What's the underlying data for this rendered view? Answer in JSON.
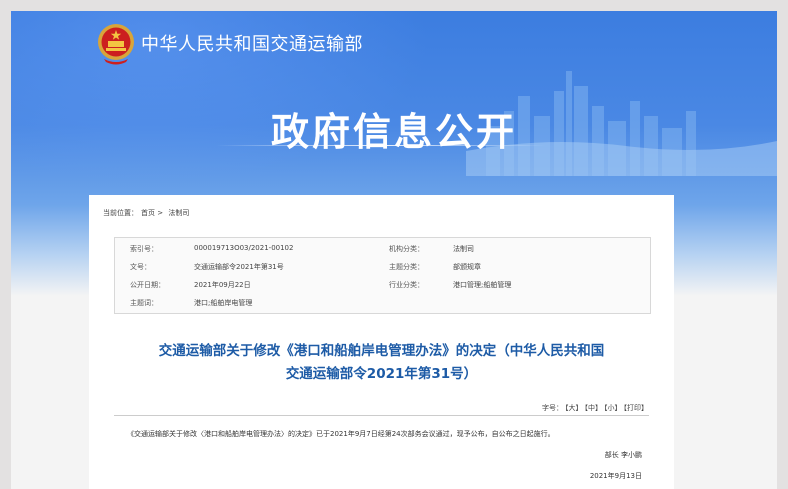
{
  "header": {
    "ministry_name": "中华人民共和国交通运输部",
    "section_title": "政府信息公开"
  },
  "breadcrumb": {
    "prefix": "当前位置：",
    "items": [
      "首页",
      ">",
      "法制司"
    ]
  },
  "meta": {
    "index_label": "索引号：",
    "index_value": "000019713O03/2021-00102",
    "org_label": "机构分类：",
    "org_value": "法制司",
    "docnum_label": "文号：",
    "docnum_value": "交通运输部令2021年第31号",
    "topic_label": "主题分类：",
    "topic_value": "部颁规章",
    "date_label": "公开日期：",
    "date_value": "2021年09月22日",
    "industry_label": "行业分类：",
    "industry_value": "港口管理;船舶管理",
    "keywords_label": "主题词：",
    "keywords_value": "港口;船舶岸电管理"
  },
  "document": {
    "title_line1": "交通运输部关于修改《港口和船舶岸电管理办法》的决定（中华人民共和国",
    "title_line2": "交通运输部令2021年第31号）",
    "body": "《交通运输部关于修改〈港口和船舶岸电管理办法〉的决定》已于2021年9月7日经第24次部务会议通过，现予公布，自公布之日起施行。",
    "signer": "部长 李小鹏",
    "sign_date": "2021年9月13日"
  },
  "fontsize": {
    "label": "字号：",
    "large": "【大】",
    "medium": "【中】",
    "small": "【小】",
    "print": "【打印】"
  },
  "colors": {
    "banner_blue": "#3c7de0",
    "title_blue": "#1d5ba6"
  }
}
